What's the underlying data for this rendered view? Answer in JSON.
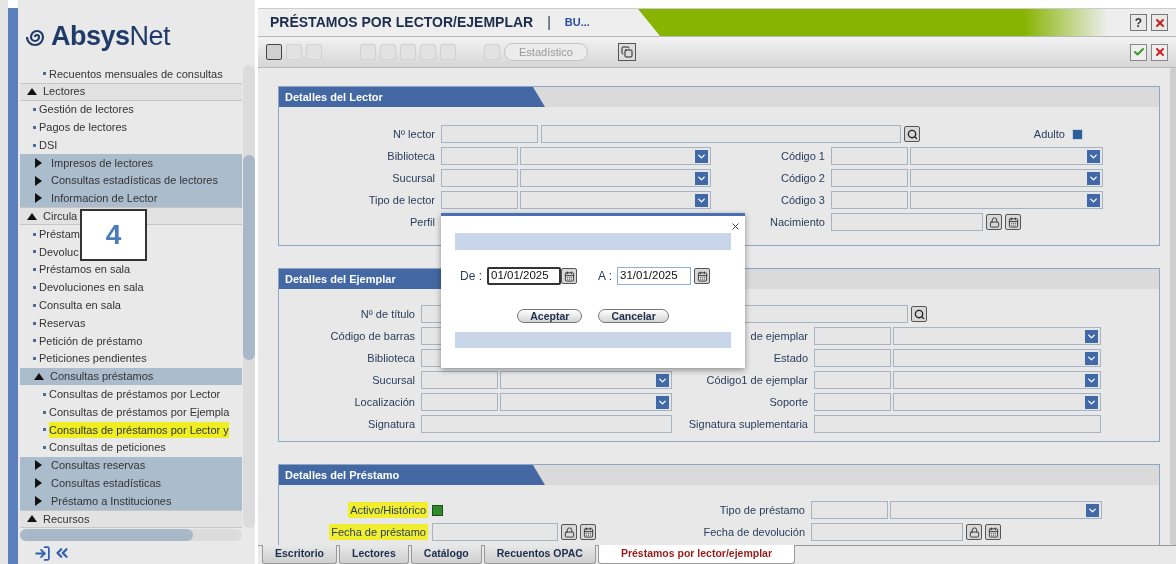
{
  "sidebar": {
    "logo": "**Absys**Net",
    "annotation": "4",
    "items": [
      {
        "kind": "subleaf",
        "label": "Recuentos mensuales de consultas",
        "highlighted": false
      },
      {
        "kind": "section",
        "label": "Lectores",
        "highlighted": false
      },
      {
        "kind": "leaf",
        "label": "Gestión de lectores",
        "highlighted": false
      },
      {
        "kind": "leaf",
        "label": "Pagos de lectores",
        "highlighted": false
      },
      {
        "kind": "leaf",
        "label": "DSI",
        "highlighted": false
      },
      {
        "kind": "group",
        "label": "Impresos de lectores",
        "highlighted": false
      },
      {
        "kind": "group",
        "label": "Consultas estadísticas de lectores",
        "highlighted": false
      },
      {
        "kind": "group",
        "label": "Informacion de Lector",
        "highlighted": false
      },
      {
        "kind": "section",
        "label": "Circula",
        "highlighted": false
      },
      {
        "kind": "leaf",
        "label": "Préstam",
        "highlighted": false
      },
      {
        "kind": "leaf",
        "label": "Devoluc",
        "highlighted": false
      },
      {
        "kind": "leaf",
        "label": "Préstamos en sala",
        "highlighted": false
      },
      {
        "kind": "leaf",
        "label": "Devoluciones en sala",
        "highlighted": false
      },
      {
        "kind": "leaf",
        "label": "Consulta en sala",
        "highlighted": false
      },
      {
        "kind": "leaf",
        "label": "Reservas",
        "highlighted": false
      },
      {
        "kind": "leaf",
        "label": "Petición de préstamo",
        "highlighted": false
      },
      {
        "kind": "leaf",
        "label": "Peticiones pendientes",
        "highlighted": false
      },
      {
        "kind": "subsection",
        "label": "Consultas préstamos",
        "highlighted": false
      },
      {
        "kind": "subleaf",
        "label": "Consultas de préstamos por Lector",
        "highlighted": false
      },
      {
        "kind": "subleaf",
        "label": "Consultas de préstamos por Ejempla",
        "highlighted": false
      },
      {
        "kind": "subleaf",
        "label": "Consultas de préstamos por Lector y",
        "highlighted": true
      },
      {
        "kind": "subleaf",
        "label": "Consultas de peticiones",
        "highlighted": false
      },
      {
        "kind": "group",
        "label": "Consultas reservas",
        "highlighted": false
      },
      {
        "kind": "group",
        "label": "Consultas estadísticas",
        "highlighted": false
      },
      {
        "kind": "group",
        "label": "Préstamo a Instituciones",
        "highlighted": false
      },
      {
        "kind": "section",
        "label": "Recursos",
        "highlighted": false
      }
    ]
  },
  "window": {
    "title": "PRÉSTAMOS POR LECTOR/EJEMPLAR",
    "separator": "|",
    "subtitle": "BU...",
    "help": "?"
  },
  "toolbar": {
    "buttons": [
      {
        "label": "Estadístico",
        "disabled": true
      }
    ]
  },
  "sections": [
    {
      "title": "Detalles del Lector",
      "rows": [
        [
          {
            "label": "Nº lector",
            "kind": "lookup",
            "highlighted": false
          },
          {
            "label": "Adulto",
            "kind": "checkbox",
            "checked": false,
            "highlighted": false
          }
        ],
        [
          {
            "label": "Biblioteca",
            "kind": "select",
            "highlighted": false
          },
          {
            "label": "Código 1",
            "kind": "select",
            "highlighted": false
          }
        ],
        [
          {
            "label": "Sucursal",
            "kind": "select",
            "highlighted": false
          },
          {
            "label": "Código 2",
            "kind": "select",
            "highlighted": false
          }
        ],
        [
          {
            "label": "Tipo de lector",
            "kind": "select",
            "highlighted": false
          },
          {
            "label": "Código 3",
            "kind": "select",
            "highlighted": false
          }
        ],
        [
          {
            "label": "Perfil",
            "kind": "covered",
            "highlighted": false
          },
          {
            "label": "Nacimiento",
            "kind": "date",
            "highlighted": false
          }
        ]
      ]
    },
    {
      "title": "Detalles del Ejemplar",
      "rows": [
        [
          {
            "label": "Nº de título",
            "kind": "lookup",
            "highlighted": false
          }
        ],
        [
          {
            "label": "Código de barras",
            "kind": "text",
            "highlighted": false
          },
          {
            "label": "de ejemplar",
            "kind": "select",
            "highlighted": false
          }
        ],
        [
          {
            "label": "Biblioteca",
            "kind": "text",
            "highlighted": false
          },
          {
            "label": "Estado",
            "kind": "select",
            "highlighted": false
          }
        ],
        [
          {
            "label": "Sucursal",
            "kind": "select",
            "highlighted": false
          },
          {
            "label": "Código1 de ejemplar",
            "kind": "select",
            "highlighted": false
          }
        ],
        [
          {
            "label": "Localización",
            "kind": "select",
            "highlighted": false
          },
          {
            "label": "Soporte",
            "kind": "select",
            "highlighted": false
          }
        ],
        [
          {
            "label": "Signatura",
            "kind": "text",
            "highlighted": false
          },
          {
            "label": "Signatura suplementaria",
            "kind": "text",
            "highlighted": false
          }
        ]
      ]
    },
    {
      "title": "Detalles del Préstamo",
      "rows": [
        [
          {
            "label": "Activo/Histórico",
            "kind": "checkbox",
            "checked": true,
            "highlighted": true
          },
          {
            "label": "Tipo de préstamo",
            "kind": "select",
            "highlighted": false
          }
        ],
        [
          {
            "label": "Fecha de préstamo",
            "kind": "date",
            "highlighted": true
          },
          {
            "label": "Fecha de devolución",
            "kind": "date",
            "highlighted": false
          }
        ]
      ]
    }
  ],
  "dialog": {
    "from_label": "De :",
    "from_value": "01/01/2025",
    "to_label": "A :",
    "to_value": "31/01/2025",
    "buttons": [
      "Aceptar",
      "Cancelar"
    ]
  },
  "tabs": [
    {
      "label": "Escritorio",
      "selected": false
    },
    {
      "label": "Lectores",
      "selected": false
    },
    {
      "label": "Catálogo",
      "selected": false
    },
    {
      "label": "Recuentos OPAC",
      "selected": false
    },
    {
      "label": "Préstamos por lector/ejemplar",
      "selected": true
    }
  ]
}
